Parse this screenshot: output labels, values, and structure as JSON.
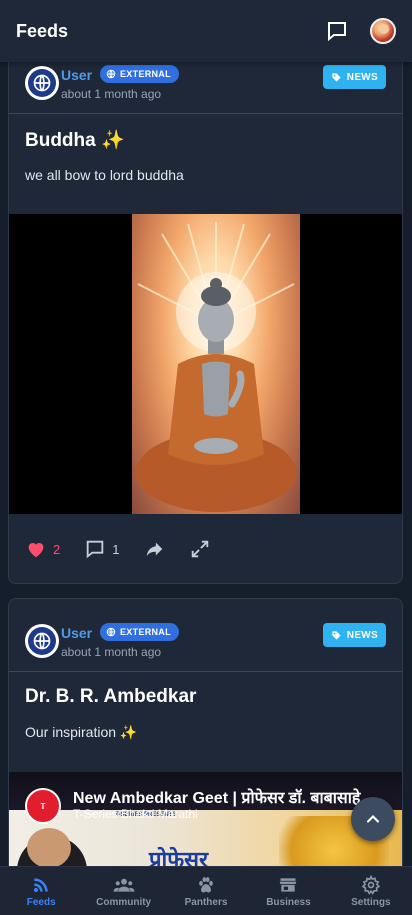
{
  "header": {
    "title": "Feeds"
  },
  "posts": [
    {
      "user": "User",
      "source_badge": "EXTERNAL",
      "time": "about 1 month ago",
      "category": "NEWS",
      "title": "Buddha ✨",
      "body": "we all bow to lord buddha",
      "likes": "2",
      "comments": "1"
    },
    {
      "user": "User",
      "source_badge": "EXTERNAL",
      "time": "about 1 month ago",
      "category": "NEWS",
      "title": "Dr. B. R. Ambedkar",
      "body": "Our inspiration ✨",
      "video": {
        "title": "New Ambedkar Geet | प्रोफेसर डॉ. बाबासाहे",
        "channel": "T-Series Bhakti Marathi",
        "banner_small": "T-SERIES PRESENTS",
        "banner_text": "प्रोफेसर"
      }
    }
  ],
  "nav": [
    {
      "label": "Feeds",
      "icon": "rss-icon",
      "active": true
    },
    {
      "label": "Community",
      "icon": "community-icon"
    },
    {
      "label": "Panthers",
      "icon": "paw-icon"
    },
    {
      "label": "Business",
      "icon": "store-icon"
    },
    {
      "label": "Settings",
      "icon": "gear-icon"
    }
  ],
  "colors": {
    "background": "#161d2b",
    "card": "#1f2838",
    "accent": "#3b82f6",
    "like": "#ff4d6d",
    "news_badge": "#2fb3f0",
    "external_badge": "#2f6fe0"
  }
}
